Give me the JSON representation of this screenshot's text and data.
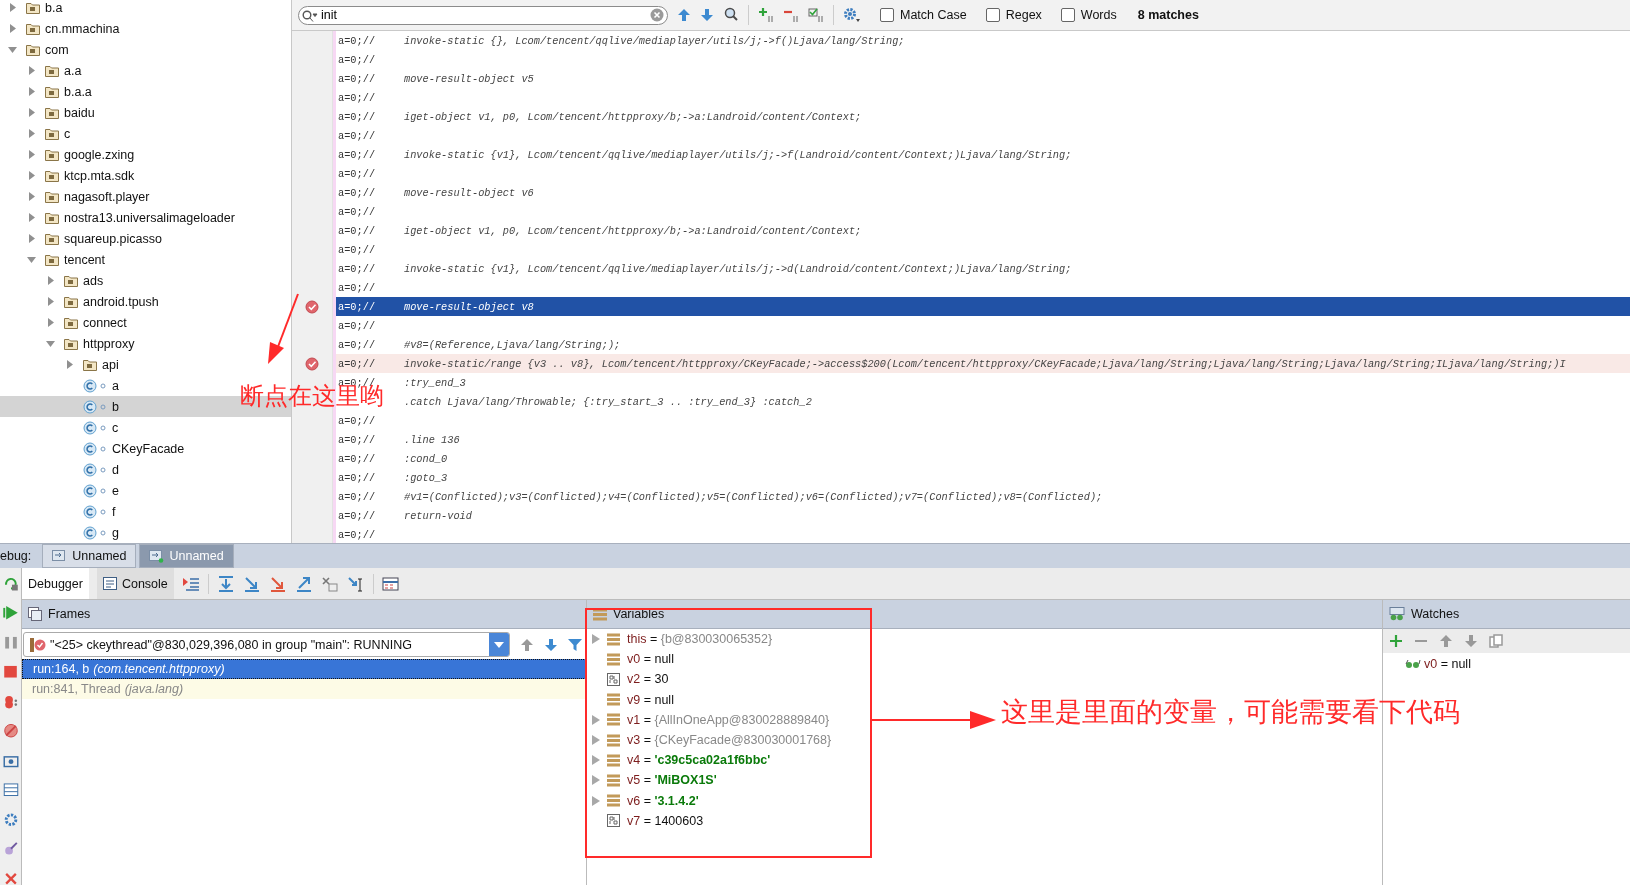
{
  "tree": [
    {
      "label": "b.a",
      "kind": "package",
      "expanded": false,
      "selected": false
    },
    {
      "label": "cn.mmachina",
      "kind": "package",
      "expanded": false,
      "selected": false
    },
    {
      "label": "com",
      "kind": "package",
      "expanded": true,
      "selected": false,
      "children": [
        {
          "label": "a.a",
          "kind": "package",
          "expanded": false,
          "selected": false
        },
        {
          "label": "b.a.a",
          "kind": "package",
          "expanded": false,
          "selected": false
        },
        {
          "label": "baidu",
          "kind": "package",
          "expanded": false,
          "selected": false
        },
        {
          "label": "c",
          "kind": "package",
          "expanded": false,
          "selected": false
        },
        {
          "label": "google.zxing",
          "kind": "package",
          "expanded": false,
          "selected": false
        },
        {
          "label": "ktcp.mta.sdk",
          "kind": "package",
          "expanded": false,
          "selected": false
        },
        {
          "label": "nagasoft.player",
          "kind": "package",
          "expanded": false,
          "selected": false
        },
        {
          "label": "nostra13.universalimageloader",
          "kind": "package",
          "expanded": false,
          "selected": false
        },
        {
          "label": "squareup.picasso",
          "kind": "package",
          "expanded": false,
          "selected": false
        },
        {
          "label": "tencent",
          "kind": "package",
          "expanded": true,
          "selected": false,
          "children": [
            {
              "label": "ads",
              "kind": "package",
              "expanded": false,
              "selected": false
            },
            {
              "label": "android.tpush",
              "kind": "package",
              "expanded": false,
              "selected": false
            },
            {
              "label": "connect",
              "kind": "package",
              "expanded": false,
              "selected": false
            },
            {
              "label": "httpproxy",
              "kind": "package",
              "expanded": true,
              "selected": false,
              "children": [
                {
                  "label": "api",
                  "kind": "package",
                  "expanded": false,
                  "selected": false
                },
                {
                  "label": "a",
                  "kind": "class",
                  "selected": false
                },
                {
                  "label": "b",
                  "kind": "class",
                  "selected": true
                },
                {
                  "label": "c",
                  "kind": "class",
                  "selected": false
                },
                {
                  "label": "CKeyFacade",
                  "kind": "class",
                  "selected": false
                },
                {
                  "label": "d",
                  "kind": "class",
                  "selected": false
                },
                {
                  "label": "e",
                  "kind": "class",
                  "selected": false
                },
                {
                  "label": "f",
                  "kind": "class",
                  "selected": false
                },
                {
                  "label": "g",
                  "kind": "class",
                  "selected": false
                }
              ]
            }
          ]
        }
      ]
    }
  ],
  "search": {
    "value": "init",
    "options": [
      {
        "label": "Match Case",
        "checked": false
      },
      {
        "label": "Regex",
        "checked": false
      },
      {
        "label": "Words",
        "checked": false
      }
    ],
    "matches": "8 matches"
  },
  "code_lines": [
    {
      "prefix": "a=0;//",
      "code": "invoke-static {}, Lcom/tencent/qqlive/mediaplayer/utils/j;->f()Ljava/lang/String;",
      "selected": false,
      "breakpoint": false
    },
    {
      "prefix": "a=0;//",
      "selected": false,
      "breakpoint": false
    },
    {
      "prefix": "a=0;//",
      "code": "move-result-object v5",
      "selected": false,
      "breakpoint": false
    },
    {
      "prefix": "a=0;//",
      "selected": false,
      "breakpoint": false
    },
    {
      "prefix": "a=0;//",
      "code": "iget-object v1, p0, Lcom/tencent/httpproxy/b;->a:Landroid/content/Context;",
      "selected": false,
      "breakpoint": false
    },
    {
      "prefix": "a=0;//",
      "selected": false,
      "breakpoint": false
    },
    {
      "prefix": "a=0;//",
      "code": "invoke-static {v1}, Lcom/tencent/qqlive/mediaplayer/utils/j;->f(Landroid/content/Context;)Ljava/lang/String;",
      "selected": false,
      "breakpoint": false
    },
    {
      "prefix": "a=0;//",
      "selected": false,
      "breakpoint": false
    },
    {
      "prefix": "a=0;//",
      "code": "move-result-object v6",
      "selected": false,
      "breakpoint": false
    },
    {
      "prefix": "a=0;//",
      "selected": false,
      "breakpoint": false
    },
    {
      "prefix": "a=0;//",
      "code": "iget-object v1, p0, Lcom/tencent/httpproxy/b;->a:Landroid/content/Context;",
      "selected": false,
      "breakpoint": false
    },
    {
      "prefix": "a=0;//",
      "selected": false,
      "breakpoint": false
    },
    {
      "prefix": "a=0;//",
      "code": "invoke-static {v1}, Lcom/tencent/qqlive/mediaplayer/utils/j;->d(Landroid/content/Context;)Ljava/lang/String;",
      "selected": false,
      "breakpoint": false
    },
    {
      "prefix": "a=0;//",
      "selected": false,
      "breakpoint": false
    },
    {
      "prefix": "a=0;//",
      "code": "move-result-object v8",
      "selected": true,
      "breakpoint": true
    },
    {
      "prefix": "a=0;//",
      "selected": false,
      "breakpoint": false
    },
    {
      "prefix": "a=0;//",
      "code": "#v8=(Reference,Ljava/lang/String;);",
      "selected": false,
      "breakpoint": false
    },
    {
      "prefix": "a=0;//",
      "code": "invoke-static/range {v3 .. v8}, Lcom/tencent/httpproxy/CKeyFacade;->access$200(Lcom/tencent/httpproxy/CKeyFacade;Ljava/lang/String;Ljava/lang/String;Ljava/lang/String;ILjava/lang/String;)I",
      "selected": false,
      "breakpoint": true
    },
    {
      "prefix": "a=0;//",
      "code": ":try_end_3",
      "selected": false,
      "breakpoint": false
    },
    {
      "code": ".catch Ljava/lang/Throwable; {:try_start_3 .. :try_end_3} :catch_2",
      "selected": false,
      "breakpoint": false
    },
    {
      "prefix": "a=0;//",
      "selected": false,
      "breakpoint": false
    },
    {
      "prefix": "a=0;//",
      "code": ".line 136",
      "selected": false,
      "breakpoint": false
    },
    {
      "prefix": "a=0;//",
      "code": ":cond_0",
      "selected": false,
      "breakpoint": false
    },
    {
      "prefix": "a=0;//",
      "code": ":goto_3",
      "selected": false,
      "breakpoint": false
    },
    {
      "prefix": "a=0;//",
      "code": "#v1=(Conflicted);v3=(Conflicted);v4=(Conflicted);v5=(Conflicted);v6=(Conflicted);v7=(Conflicted);v8=(Conflicted);",
      "selected": false,
      "breakpoint": false
    },
    {
      "prefix": "a=0;//",
      "code": "return-void",
      "selected": false,
      "breakpoint": false
    },
    {
      "prefix": "a=0;//",
      "selected": false,
      "breakpoint": false
    }
  ],
  "debug_tabs": {
    "label": "ebug:",
    "tabs": [
      {
        "label": "Unnamed",
        "selected": false
      },
      {
        "label": "Unnamed",
        "selected": true
      }
    ]
  },
  "debug_toolbar_tabs": [
    {
      "label": "Debugger",
      "selected": true
    },
    {
      "label": "Console",
      "selected": false
    }
  ],
  "frames": {
    "title": "Frames",
    "thread": "\"<25> ckeythread\"@830,029,396,080 in group \"main\": RUNNING",
    "items": [
      {
        "method": "run:164, b",
        "package": "(com.tencent.httpproxy)",
        "selected": true,
        "library": false
      },
      {
        "method": "run:841, Thread",
        "package": "(java.lang)",
        "selected": false,
        "library": true
      }
    ]
  },
  "variables": {
    "title": "Variables",
    "items": [
      {
        "name": "this",
        "sep": "=",
        "value": "{b@830030065352}",
        "kind": "object",
        "expandable": true
      },
      {
        "name": "v0",
        "sep": "=",
        "value": "null",
        "kind": "null",
        "expandable": false
      },
      {
        "name": "v2",
        "sep": "=",
        "value": "30",
        "kind": "primitive",
        "expandable": false
      },
      {
        "name": "v9",
        "sep": "=",
        "value": "null",
        "kind": "null",
        "expandable": false
      },
      {
        "name": "v1",
        "sep": "=",
        "value": "{AllInOneApp@830028889840}",
        "kind": "object",
        "expandable": true
      },
      {
        "name": "v3",
        "sep": "=",
        "value": "{CKeyFacade@830030001768}",
        "kind": "object",
        "expandable": true
      },
      {
        "name": "v4",
        "sep": "=",
        "value": "'c39c5ca02a1f6bbc'",
        "kind": "string",
        "expandable": true
      },
      {
        "name": "v5",
        "sep": "=",
        "value": "'MiBOX1S'",
        "kind": "string",
        "expandable": true
      },
      {
        "name": "v6",
        "sep": "=",
        "value": "'3.1.4.2'",
        "kind": "string",
        "expandable": true
      },
      {
        "name": "v7",
        "sep": "=",
        "value": "1400603",
        "kind": "primitive",
        "expandable": false
      }
    ]
  },
  "watches": {
    "title": "Watches",
    "items": [
      {
        "name": "v0",
        "sep": "=",
        "value": "null"
      }
    ]
  },
  "annotations": [
    {
      "text": "断点在这里哟"
    },
    {
      "text": "这里是里面的变量，可能需要看下代码"
    }
  ]
}
